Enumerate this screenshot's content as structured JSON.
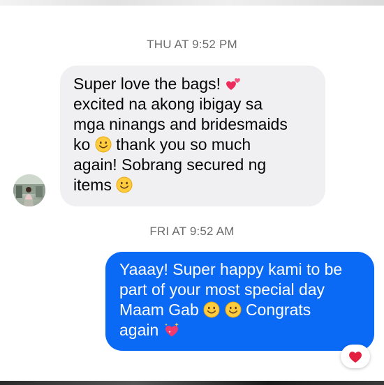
{
  "conversation": {
    "timestamp_1": "THU AT 9:52 PM",
    "timestamp_2": "FRI AT 9:52 AM",
    "incoming": {
      "avatar_icon": "user-avatar",
      "lines": [
        "Super love the bags!",
        "excited na akong ibigay sa",
        "mga ninangs and bridesmaids",
        "ko",
        "thank you so much",
        "again! Sobrang secured ng",
        "items"
      ],
      "emojis": [
        "two-hearts-emoji",
        "smiling-face-emoji",
        "smiling-face-emoji"
      ]
    },
    "outgoing": {
      "lines": [
        "Yaaay! Super happy kami to be",
        "part of your most special day",
        "Maam Gab",
        "Congrats",
        "again"
      ],
      "emojis": [
        "smiling-face-emoji",
        "smiling-face-emoji",
        "sparkling-heart-emoji"
      ]
    },
    "reaction": {
      "icon": "red-heart-reaction-icon",
      "color": "#e41e3f"
    }
  },
  "colors": {
    "incoming_bubble": "#f0f0f2",
    "outgoing_bubble": "#0a69f5",
    "timestamp_text": "#6b6b6b"
  }
}
